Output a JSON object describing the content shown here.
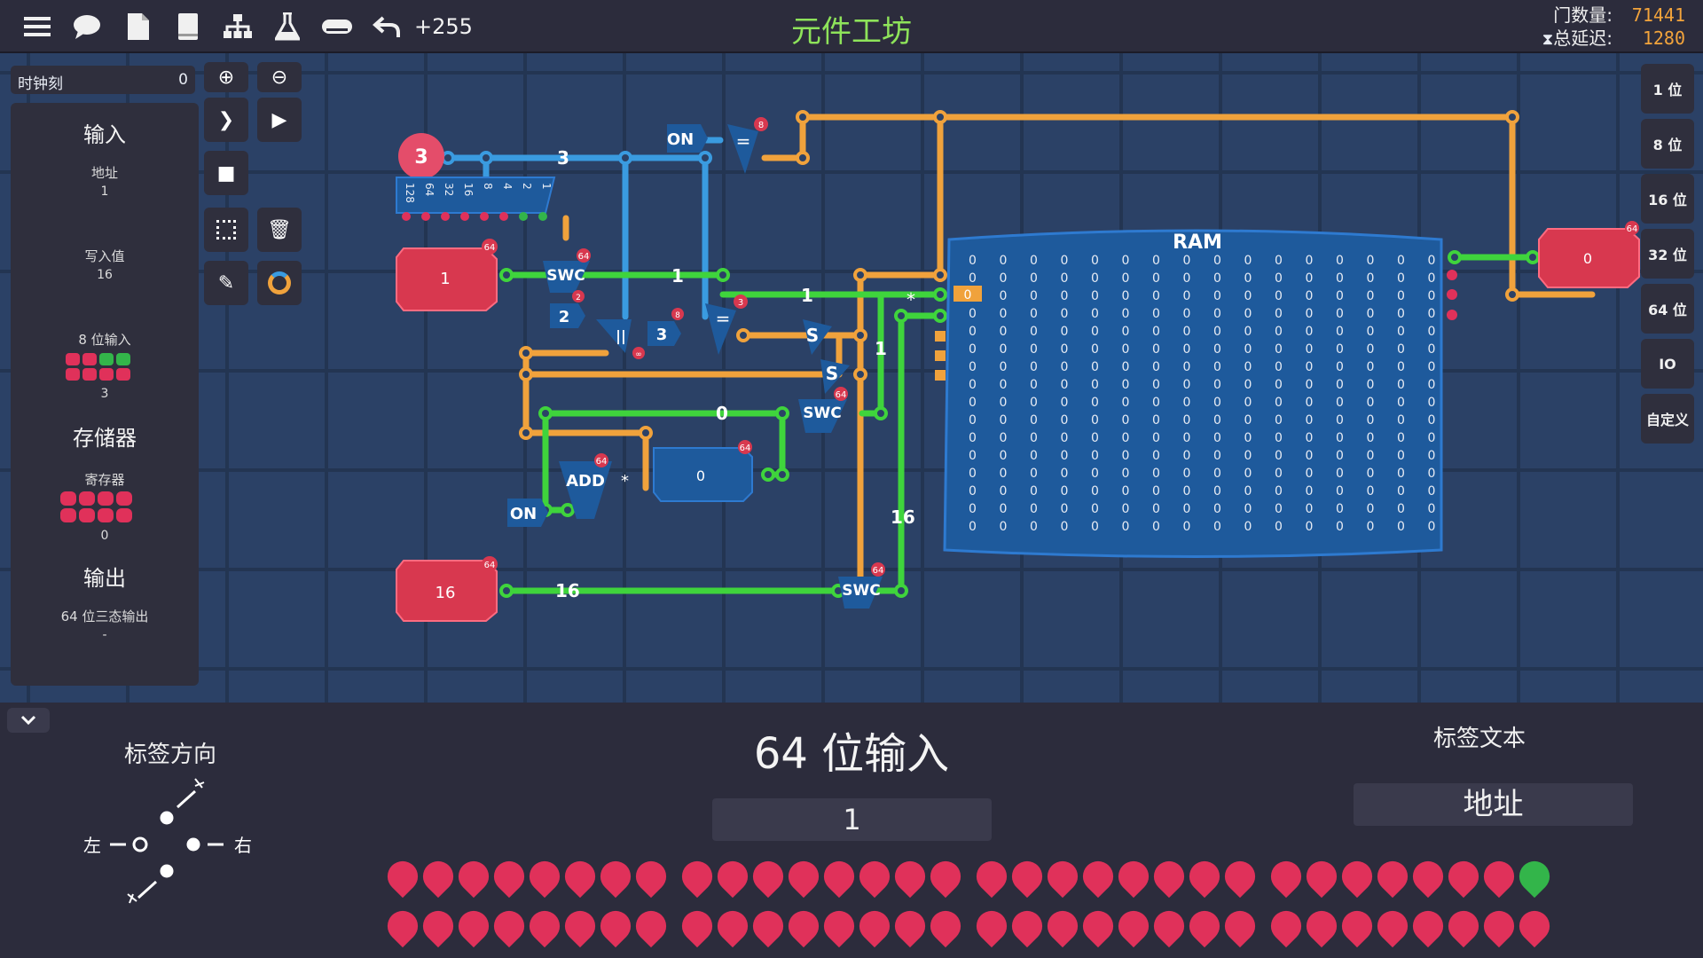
{
  "app": {
    "title": "元件工坊"
  },
  "toolbar": {
    "undo_count": "+255"
  },
  "stats": {
    "gate_label": "门数量:",
    "gate_value": "71441",
    "delay_label": "总延迟:",
    "delay_value": "1280"
  },
  "clock": {
    "label": "时钟刻",
    "value": "0"
  },
  "palette": {
    "input_header": "输入",
    "address_label": "地址",
    "address_value": "1",
    "write_label": "写入值",
    "write_value": "16",
    "byte_label": "8 位输入",
    "byte_value": "3",
    "memory_header": "存储器",
    "register_label": "寄存器",
    "register_value": "0",
    "output_header": "输出",
    "tristate_label": "64 位三态输出",
    "tristate_value": "-"
  },
  "bit_sizes": [
    "1 位",
    "8 位",
    "16 位",
    "32 位",
    "64 位",
    "IO",
    "自定义"
  ],
  "circuit": {
    "input_byte_value": "3",
    "byte_bits": [
      "128",
      "64",
      "32",
      "16",
      "8",
      "4",
      "2",
      "1"
    ],
    "addr_input_value": "1",
    "write_input_value": "16",
    "register_value": "0",
    "output_value": "0",
    "ram_title": "RAM",
    "ram_row_marker": "0",
    "wire_labels": {
      "w3": "3",
      "w1a": "1",
      "w1b": "1",
      "w1c": "1",
      "w0": "0",
      "w16a": "16",
      "w16b": "16"
    },
    "const_on": "ON",
    "swc": "SWC",
    "add": "ADD",
    "s": "S",
    "eq": "=",
    "or": "||",
    "mul": "*",
    "const2": "2",
    "const3": "3",
    "badge64": "64",
    "badge8": "8",
    "badge2": "2",
    "badge3": "3",
    "badge_inf": "∞"
  },
  "bottom": {
    "dir_header": "标签方向",
    "dir_left": "左",
    "dir_right": "右",
    "component_title": "64 位输入",
    "value": "1",
    "label_text_header": "标签文本",
    "label_text_value": "地址"
  },
  "bits_row1": [
    0,
    0,
    0,
    0,
    0,
    0,
    0,
    0,
    0,
    0,
    0,
    0,
    0,
    0,
    0,
    0,
    0,
    0,
    0,
    0,
    0,
    0,
    0,
    0,
    0,
    0,
    0,
    0,
    0,
    0,
    0,
    1
  ],
  "bits_row2": [
    0,
    0,
    0,
    0,
    0,
    0,
    0,
    0,
    0,
    0,
    0,
    0,
    0,
    0,
    0,
    0,
    0,
    0,
    0,
    0,
    0,
    0,
    0,
    0,
    0,
    0,
    0,
    0,
    0,
    0,
    0,
    0
  ],
  "colors": {
    "wire_orange": "#f0a23c",
    "wire_green": "#3fd43c",
    "wire_blue": "#3a9be0",
    "bit_off": "#e0315a",
    "bit_on": "#33b54a",
    "ram_fill": "#1e5a9c"
  }
}
